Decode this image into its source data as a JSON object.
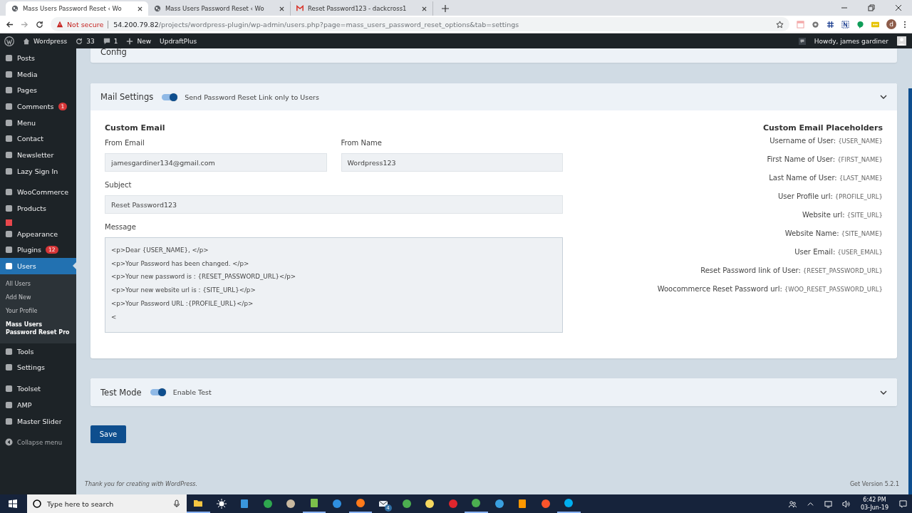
{
  "browser": {
    "tabs": [
      {
        "title": "Mass Users Password Reset ‹ Wo",
        "selected": true,
        "kind": "globe"
      },
      {
        "title": "Mass Users Password Reset ‹ Wo",
        "selected": false,
        "kind": "globe"
      },
      {
        "title": "Reset Password123 - dackcross1",
        "selected": false,
        "kind": "mail"
      }
    ],
    "security": "Not secure",
    "url_host": "54.200.79.82",
    "url_path": "/projects/wordpress-plugin/wp-admin/users.php?page=mass_users_password_reset_options&tab=settings",
    "profile_initial": "d"
  },
  "admin_bar": {
    "site": "Wordpress",
    "updates": "33",
    "comments": "1",
    "new": "New",
    "plugin": "UpdraftPlus",
    "greeting": "Howdy, james gardiner"
  },
  "sidebar": {
    "groups": [
      [
        {
          "kind": "item",
          "label": "Posts",
          "selected": false
        },
        {
          "kind": "item",
          "label": "Media",
          "selected": false
        },
        {
          "kind": "item",
          "label": "Pages",
          "selected": false
        },
        {
          "kind": "item",
          "label": "Comments",
          "badge": "1",
          "selected": false
        },
        {
          "kind": "item",
          "label": "Menu",
          "selected": false
        },
        {
          "kind": "item",
          "label": "Contact",
          "selected": false
        },
        {
          "kind": "item",
          "label": "Newsletter",
          "selected": false
        },
        {
          "kind": "item",
          "label": "Lazy Sign In",
          "selected": false
        }
      ],
      [
        {
          "kind": "item",
          "label": "WooCommerce",
          "selected": false
        },
        {
          "kind": "item",
          "label": "Products",
          "selected": false
        },
        {
          "kind": "square"
        },
        {
          "kind": "item",
          "label": "Appearance",
          "selected": false
        },
        {
          "kind": "item",
          "label": "Plugins",
          "badge": "12",
          "selected": false
        },
        {
          "kind": "item",
          "label": "Users",
          "selected": true,
          "children": [
            {
              "label": "All Users",
              "selected": false
            },
            {
              "label": "Add New",
              "selected": false
            },
            {
              "label": "Your Profile",
              "selected": false
            },
            {
              "label": "Mass Users Password Reset Pro",
              "selected": true
            }
          ]
        },
        {
          "kind": "item",
          "label": "Tools",
          "selected": false
        },
        {
          "kind": "item",
          "label": "Settings",
          "selected": false
        }
      ],
      [
        {
          "kind": "item",
          "label": "Toolset",
          "selected": false
        },
        {
          "kind": "item",
          "label": "AMP",
          "selected": false
        },
        {
          "kind": "item",
          "label": "Master Slider",
          "selected": false
        }
      ]
    ],
    "collapse": "Collapse menu"
  },
  "config": {
    "title": "Config"
  },
  "mail": {
    "title": "Mail Settings",
    "toggle": {
      "on": true,
      "label": "Send Password Reset Link only to Users"
    },
    "custom_email_title": "Custom Email",
    "from_email": {
      "label": "From Email",
      "value": "jamesgardiner134@gmail.com"
    },
    "from_name": {
      "label": "From Name",
      "value": "Wordpress123"
    },
    "subject": {
      "label": "Subject",
      "value": "Reset Password123"
    },
    "message": {
      "label": "Message",
      "value": "<p>Dear {USER_NAME}, </p>\n<p>Your Password has been changed. </p>\n<p>Your new password is : {RESET_PASSWORD_URL}</p>\n<p>Your new website url is : {SITE_URL}</p>\n<p>Your Password URL :{PROFILE_URL}</p>\n<"
    },
    "placeholders_title": "Custom Email Placeholders",
    "placeholders": [
      {
        "label": "Username of User:",
        "token": "{USER_NAME}"
      },
      {
        "label": "First Name of User:",
        "token": "{FIRST_NAME}"
      },
      {
        "label": "Last Name of User:",
        "token": "{LAST_NAME}"
      },
      {
        "label": "User Profile url:",
        "token": "{PROFILE_URL}"
      },
      {
        "label": "Website url:",
        "token": "{SITE_URL}"
      },
      {
        "label": "Website Name:",
        "token": "{SITE_NAME}"
      },
      {
        "label": "User Email:",
        "token": "{USER_EMAIL}"
      },
      {
        "label": "Reset Password link of User:",
        "token": "{RESET_PASSWORD_URL}"
      },
      {
        "label": "Woocommerce Reset Password url:",
        "token": "{WOO_RESET_PASSWORD_URL}"
      }
    ]
  },
  "test": {
    "title": "Test Mode",
    "toggle": {
      "on": true,
      "label": "Enable Test"
    }
  },
  "save": "Save",
  "footer": {
    "thanks": "Thank you for creating with WordPress.",
    "version": "Get Version 5.2.1"
  },
  "taskbar": {
    "search_placeholder": "Type here to search",
    "apps": [
      {
        "kind": "folder",
        "running": true
      },
      {
        "kind": "sun",
        "running": false
      },
      {
        "kind": "store",
        "running": false
      },
      {
        "kind": "pipe",
        "running": false
      },
      {
        "kind": "palette",
        "running": false
      },
      {
        "kind": "notepad",
        "running": true
      },
      {
        "kind": "edge",
        "running": false
      },
      {
        "kind": "firefox",
        "running": true
      },
      {
        "kind": "mail",
        "running": false,
        "badge": "4"
      },
      {
        "kind": "chrome",
        "running": false
      },
      {
        "kind": "smiley",
        "running": false
      },
      {
        "kind": "opera",
        "running": false
      },
      {
        "kind": "chrome",
        "running": true
      },
      {
        "kind": "ie",
        "running": false
      },
      {
        "kind": "sublime",
        "running": false
      },
      {
        "kind": "brave",
        "running": false
      },
      {
        "kind": "skype",
        "running": true
      }
    ],
    "time": "6:42 PM",
    "date": "03-Jun-19"
  }
}
